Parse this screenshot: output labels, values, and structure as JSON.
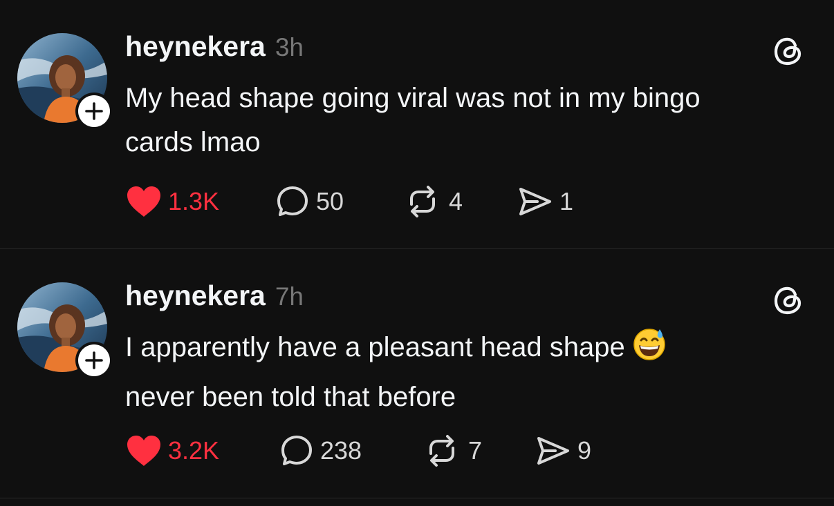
{
  "posts": [
    {
      "username": "heynekera",
      "time": "3h",
      "text_line1": "My head shape going viral was not in my bingo",
      "text_line2": "cards lmao",
      "likes": "1.3K",
      "comments": "50",
      "reposts": "4",
      "shares": "1",
      "liked": true
    },
    {
      "username": "heynekera",
      "time": "7h",
      "text_line1": "I apparently have a pleasant head shape",
      "emoji": "grinning-face-with-sweat",
      "text_line2": "never been told that before",
      "likes": "3.2K",
      "comments": "238",
      "reposts": "7",
      "shares": "9",
      "liked": true
    }
  ],
  "icons": {
    "like": "heart-icon",
    "comment": "comment-bubble-icon",
    "repost": "repost-icon",
    "share": "share-send-icon",
    "app": "threads-logo-icon",
    "follow": "plus-icon"
  },
  "colors": {
    "background": "#101010",
    "text": "#f3f5f7",
    "muted": "#777777",
    "liked": "#ff3040",
    "divider": "#2a2a2a"
  }
}
